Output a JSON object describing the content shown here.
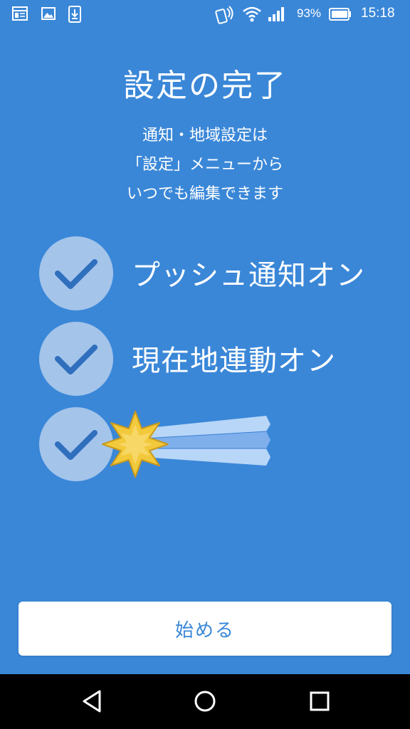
{
  "status_bar": {
    "battery_percent": "93%",
    "time": "15:18",
    "icons": [
      "notebook-icon",
      "image-icon",
      "download-icon",
      "nfc-icon",
      "wifi-icon",
      "signal-icon",
      "battery-icon"
    ]
  },
  "setup": {
    "title": "設定の完了",
    "subtitle_lines": [
      "通知・地域設定は",
      "「設定」メニューから",
      "いつでも編集できます"
    ],
    "items": [
      {
        "label": "プッシュ通知オン",
        "checked": true
      },
      {
        "label": "現在地連動オン",
        "checked": true
      },
      {
        "label": "",
        "checked": true,
        "decoration": "shooting-star-icon"
      }
    ]
  },
  "start_button": {
    "label": "始める"
  },
  "nav_bar": {
    "buttons": [
      "back-icon",
      "home-icon",
      "recents-icon"
    ]
  },
  "colors": {
    "background": "#3a87d8",
    "check_circle": "#a4c4ea",
    "check_mark": "#2f6fbd"
  }
}
